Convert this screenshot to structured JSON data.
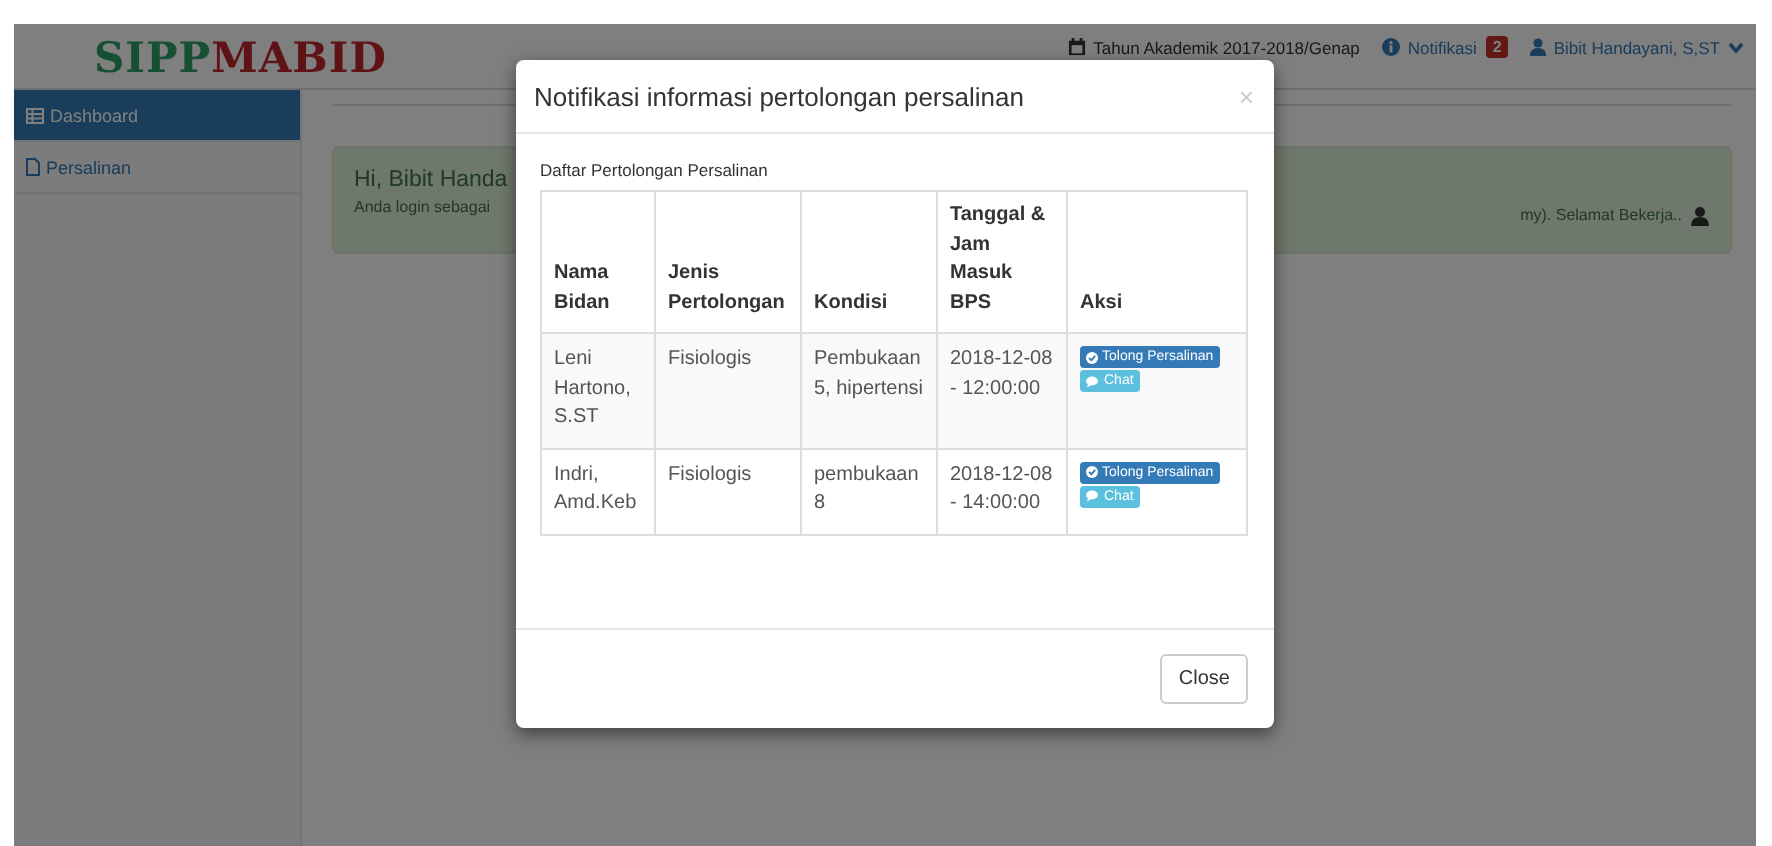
{
  "header": {
    "logo": {
      "first": "SIPP",
      "second": "MABID"
    },
    "academic_year": "Tahun Akademik 2017-2018/Genap",
    "notifications": {
      "label": "Notifikasi",
      "count": "2"
    },
    "user": "Bibit Handayani, S,ST"
  },
  "sidebar": {
    "items": [
      {
        "label": "Dashboard",
        "selected": true
      },
      {
        "label": "Persalinan",
        "selected": false
      }
    ]
  },
  "alert": {
    "greeting": "Hi, Bibit Handa",
    "message_start": "Anda login sebagai",
    "message_end": "my). Selamat Bekerja.."
  },
  "modal": {
    "title": "Notifikasi informasi pertolongan persalinan",
    "close_symbol": "×",
    "subtitle": "Daftar Pertolongan Persalinan",
    "table": {
      "columns": [
        "Nama Bidan",
        "Jenis Pertolongan",
        "Kondisi",
        "Tanggal & Jam Masuk BPS",
        "Aksi"
      ],
      "rows": [
        {
          "cells": [
            "Leni Hartono, S.ST",
            "Fisiologis",
            "Pembukaan 5, hipertensi",
            "2018-12-08 - 12:00:00"
          ],
          "actions": [
            {
              "kind": "primary",
              "label": "Tolong Persalinan"
            },
            {
              "kind": "info",
              "label": "Chat"
            }
          ]
        },
        {
          "cells": [
            "Indri, Amd.Keb",
            "Fisiologis",
            "pembukaan 8",
            "2018-12-08 - 14:00:00"
          ],
          "actions": [
            {
              "kind": "primary",
              "label": "Tolong Persalinan"
            },
            {
              "kind": "info",
              "label": "Chat"
            }
          ]
        }
      ]
    },
    "footer_button": "Close"
  }
}
